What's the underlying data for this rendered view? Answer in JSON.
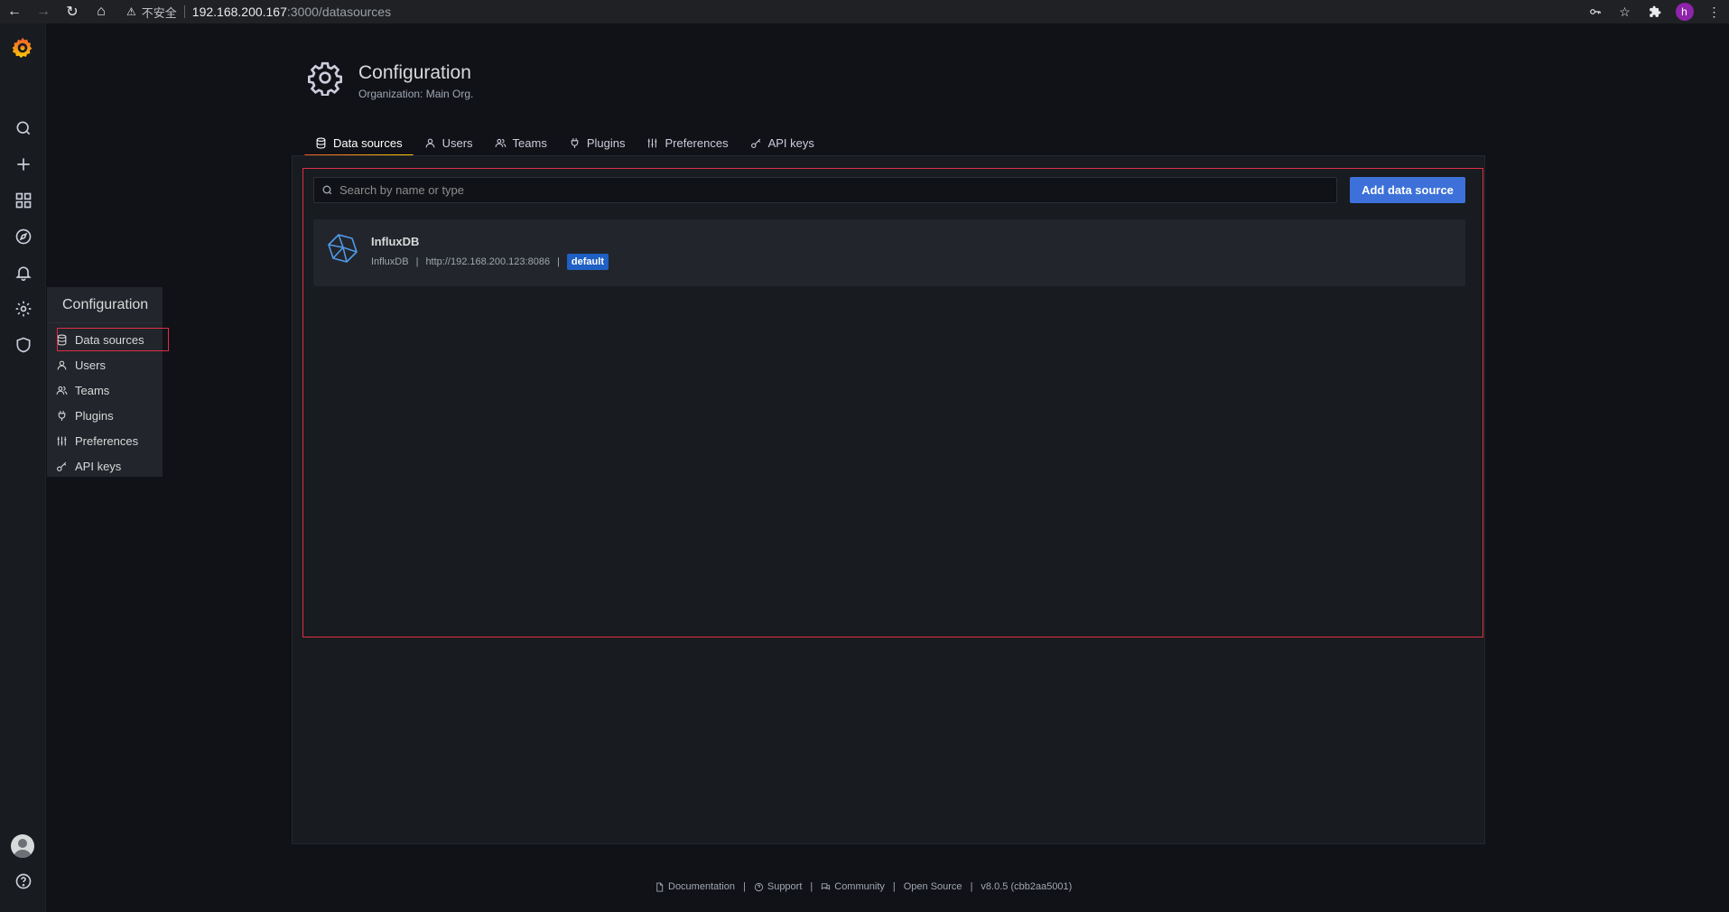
{
  "browser": {
    "security_label": "不安全",
    "url_host": "192.168.200.167",
    "url_path": ":3000/datasources",
    "profile_initial": "h"
  },
  "sidebar": {
    "items": [
      {
        "name": "search",
        "icon": "search-icon"
      },
      {
        "name": "create",
        "icon": "plus-icon"
      },
      {
        "name": "dashboards",
        "icon": "apps-icon"
      },
      {
        "name": "explore",
        "icon": "compass-icon"
      },
      {
        "name": "alerting",
        "icon": "bell-icon"
      },
      {
        "name": "configuration",
        "icon": "cog-icon"
      },
      {
        "name": "server-admin",
        "icon": "shield-icon"
      }
    ]
  },
  "flyout": {
    "title": "Configuration",
    "items": [
      {
        "label": "Data sources",
        "icon": "database-icon"
      },
      {
        "label": "Users",
        "icon": "user-icon"
      },
      {
        "label": "Teams",
        "icon": "users-icon"
      },
      {
        "label": "Plugins",
        "icon": "plug-icon"
      },
      {
        "label": "Preferences",
        "icon": "sliders-icon"
      },
      {
        "label": "API keys",
        "icon": "key-icon"
      }
    ]
  },
  "header": {
    "title": "Configuration",
    "subtitle": "Organization: Main Org."
  },
  "tabs": [
    {
      "label": "Data sources",
      "icon": "database-icon",
      "active": true
    },
    {
      "label": "Users",
      "icon": "user-icon"
    },
    {
      "label": "Teams",
      "icon": "users-icon"
    },
    {
      "label": "Plugins",
      "icon": "plug-icon"
    },
    {
      "label": "Preferences",
      "icon": "sliders-icon"
    },
    {
      "label": "API keys",
      "icon": "key-icon"
    }
  ],
  "toolbar": {
    "search_placeholder": "Search by name or type",
    "add_label": "Add data source"
  },
  "datasources": [
    {
      "name": "InfluxDB",
      "type": "InfluxDB",
      "url": "http://192.168.200.123:8086",
      "badge": "default"
    }
  ],
  "footer": {
    "documentation": "Documentation",
    "support": "Support",
    "community": "Community",
    "open_source": "Open Source",
    "version": "v8.0.5 (cbb2aa5001)"
  },
  "colors": {
    "accent": "#3d71d9",
    "highlight": "#e02f44",
    "badge": "#1f60c4"
  }
}
